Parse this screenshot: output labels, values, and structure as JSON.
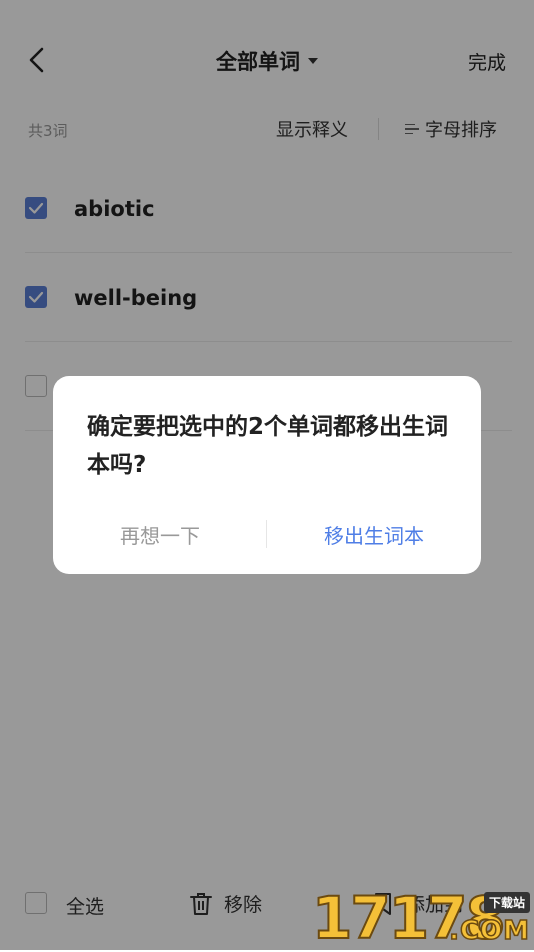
{
  "header": {
    "title": "全部单词",
    "done_label": "完成"
  },
  "toolbar": {
    "count_label": "共3词",
    "show_definition_label": "显示释义",
    "sort_label": "字母排序"
  },
  "words": [
    {
      "word": "abiotic",
      "checked": true
    },
    {
      "word": "well-being",
      "checked": true
    },
    {
      "word": "",
      "checked": false
    }
  ],
  "bottom_bar": {
    "select_all_label": "全选",
    "remove_label": "移除",
    "add_label": "添加到"
  },
  "dialog": {
    "message": "确定要把选中的2个单词都移出生词本吗?",
    "cancel_label": "再想一下",
    "confirm_label": "移出生词本"
  },
  "watermark": {
    "number": "17178",
    "tag": "下载站",
    "domain": ".COM"
  },
  "colors": {
    "accent": "#5b7fd6",
    "confirm": "#4f7ee6",
    "overlay": "rgba(0,0,0,0.40)"
  },
  "icons": [
    "chevron-left-icon",
    "caret-down-icon",
    "sort-icon",
    "check-icon",
    "trash-icon",
    "bookmark-plus-icon"
  ]
}
